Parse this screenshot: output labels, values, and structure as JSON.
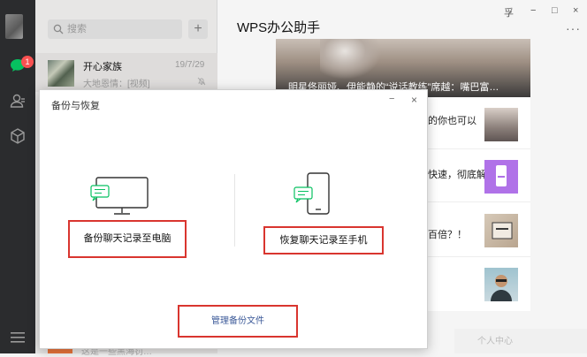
{
  "window": {
    "controls": {
      "pin": "孚",
      "minimize": "−",
      "maximize": "□",
      "close": "×"
    }
  },
  "sidebar": {
    "badge_count": "1",
    "icons": [
      "avatar",
      "chat-icon",
      "contacts-icon",
      "favorites-icon",
      "menu-icon"
    ]
  },
  "chatlist": {
    "search_placeholder": "搜索",
    "add_label": "+",
    "item": {
      "name": "开心家族",
      "time": "19/7/29",
      "preview": "大地恩情：[视频]"
    },
    "bottom_item_text": "这是一些黑海罚…"
  },
  "main": {
    "title": "WPS办公助手",
    "more": "···",
    "hero_caption": "明星佟丽娅、伊能静的“说话教练”席越：嘴巴富…",
    "articles": [
      {
        "text": "的你也可以"
      },
      {
        "text": "快速，彻底解"
      },
      {
        "text": "百倍？！"
      },
      {
        "text": ""
      }
    ],
    "bottom_bar_text": "个人中心"
  },
  "dialog": {
    "title": "备份与恢复",
    "minimize": "−",
    "close": "×",
    "backup_label": "备份聊天记录至电脑",
    "restore_label": "恢复聊天记录至手机",
    "manage_label": "管理备份文件"
  },
  "colors": {
    "accent_green": "#07c160",
    "highlight_red": "#d9352f",
    "sidebar_bg": "#2b2c2e"
  }
}
